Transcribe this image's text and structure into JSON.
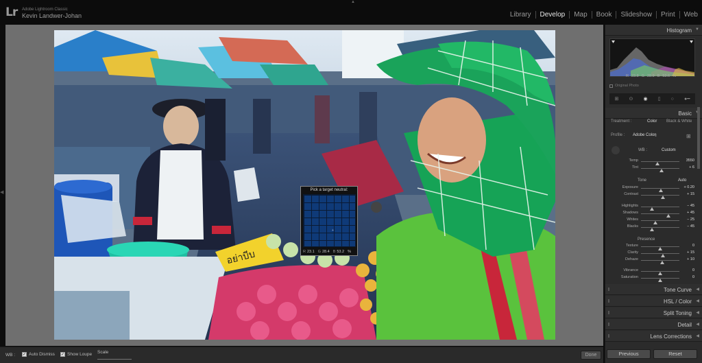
{
  "app": {
    "logo": "Lr",
    "app_name": "Adobe Lightroom Classic",
    "user_name": "Kevin Landwer-Johan"
  },
  "modules": [
    "Library",
    "Develop",
    "Map",
    "Book",
    "Slideshow",
    "Print",
    "Web"
  ],
  "active_module": "Develop",
  "loupe": {
    "title": "Pick a target neutral:",
    "r_label": "R",
    "r_value": "23.1",
    "g_label": "G",
    "g_value": "28.4",
    "b_label": "B",
    "b_value": "53.2",
    "unit": "%"
  },
  "photo": {
    "sign_text": "อย่าบีบ"
  },
  "bottom": {
    "wb_label": "WB :",
    "auto_dismiss": "Auto Dismiss",
    "show_loupe": "Show Loupe",
    "scale": "Scale",
    "done": "Done"
  },
  "panel": {
    "histogram": "Histogram",
    "histo_r_label": "R",
    "histo_r": "23.8",
    "histo_g_label": "G",
    "histo_g": "28.9",
    "histo_b_label": "B",
    "histo_b": "53.6",
    "histo_unit": "%",
    "original_photo": "Original Photo",
    "basic": "Basic",
    "treatment_label": "Treatment :",
    "treatment_color": "Color",
    "treatment_bw": "Black & White",
    "profile_label": "Profile :",
    "profile_value": "Adobe Color",
    "wb_label": "WB :",
    "wb_value": "Custom",
    "tone_label": "Tone",
    "auto_label": "Auto",
    "presence_label": "Presence",
    "sliders_wb": [
      {
        "name": "Temp",
        "value": "3550",
        "pos": 0.42
      },
      {
        "name": "Tint",
        "value": "+ 6",
        "pos": 0.53
      }
    ],
    "sliders_tone": [
      {
        "name": "Exposure",
        "value": "+ 0.20",
        "pos": 0.52
      },
      {
        "name": "Contrast",
        "value": "+ 15",
        "pos": 0.57
      }
    ],
    "sliders_tone2": [
      {
        "name": "Highlights",
        "value": "− 45",
        "pos": 0.28
      },
      {
        "name": "Shadows",
        "value": "+ 45",
        "pos": 0.72
      },
      {
        "name": "Whites",
        "value": "− 25",
        "pos": 0.38
      },
      {
        "name": "Blacks",
        "value": "− 45",
        "pos": 0.28
      }
    ],
    "sliders_presence": [
      {
        "name": "Texture",
        "value": "0",
        "pos": 0.5
      },
      {
        "name": "Clarity",
        "value": "+ 15",
        "pos": 0.57
      },
      {
        "name": "Dehaze",
        "value": "+ 10",
        "pos": 0.55
      }
    ],
    "sliders_sat": [
      {
        "name": "Vibrance",
        "value": "0",
        "pos": 0.5
      },
      {
        "name": "Saturation",
        "value": "0",
        "pos": 0.5
      }
    ],
    "tone_curve": "Tone Curve",
    "hsl": "HSL / Color",
    "split_toning": "Split Toning",
    "detail": "Detail",
    "lens_corrections": "Lens Corrections",
    "previous": "Previous",
    "reset": "Reset"
  }
}
